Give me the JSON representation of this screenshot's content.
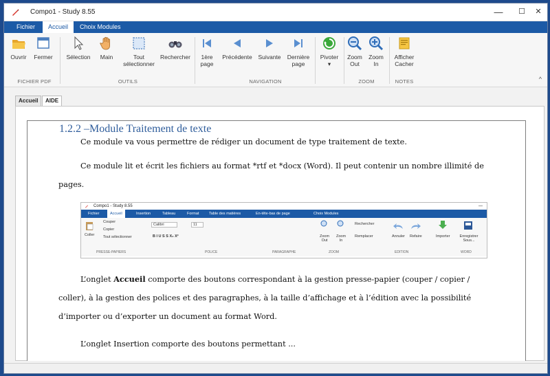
{
  "window": {
    "title": "Compo1 - Study 8.55",
    "controls": {
      "minimize": "—",
      "maximize": "☐",
      "close": "✕"
    }
  },
  "menubar": {
    "tabs": [
      {
        "label": "Fichier"
      },
      {
        "label": "Accueil"
      },
      {
        "label": "Choix Modules"
      }
    ]
  },
  "ribbon": {
    "buttons": {
      "ouvrir": "Ouvrir",
      "fermer": "Fermer",
      "selection": "Sélection",
      "main": "Main",
      "tout_sel_1": "Tout",
      "tout_sel_2": "sélectionner",
      "rechercher": "Rechercher",
      "premiere_1": "1ère",
      "premiere_2": "page",
      "precedente": "Précédente",
      "suivante": "Suivante",
      "derniere_1": "Dernière",
      "derniere_2": "page",
      "pivoter": "Pivoter",
      "pivoter_arrow": "▾",
      "zoomout_1": "Zoom",
      "zoomout_2": "Out",
      "zoomin_1": "Zoom",
      "zoomin_2": "In",
      "afficher_1": "Afficher",
      "afficher_2": "Cacher"
    },
    "groups": {
      "fichier_pdf": "FICHIER PDF",
      "outils": "OUTILS",
      "navigation": "NAVIGATION",
      "zoom": "ZOOM",
      "notes": "NOTES"
    },
    "collapse": "^"
  },
  "doc_tabs": [
    {
      "label": "Accueil"
    },
    {
      "label": "AIDE"
    }
  ],
  "document": {
    "heading": "1.2.2 –Module Traitement de texte",
    "p1": "Ce module va vous permettre de rédiger un document de type traitement de texte.",
    "p2": "Ce module lit et écrit les fichiers au format *rtf et *docx (Word). Il peut contenir un nombre illimité de pages.",
    "p3_before": "L’onglet ",
    "p3_bold": "Accueil",
    "p3_after": " comporte des boutons correspondant à la gestion presse-papier (couper / copier / coller), à la gestion des polices et des paragraphes, à la taille d’affichage et à l’édition avec la possibilité d’importer ou d’exporter un document au format Word.",
    "p4_partial": "L’onglet Insertion comporte des boutons permettant ..."
  },
  "embedded_screenshot": {
    "title": "Compo1 - Study 8.55",
    "close": "—",
    "tabs": [
      "Fichier",
      "Accueil",
      "Insertion",
      "Tableau",
      "Format",
      "Table des matières",
      "En-tête-bas de page",
      "Choix Modules"
    ],
    "coller": "Coller",
    "couper": "Couper",
    "copier": "Copier",
    "tout_sel": "Tout sélectionner",
    "font": "Calibri",
    "size": "11",
    "fmt_row": "B  I  U  S  S  X₂  X²",
    "rechercher": "Rechercher",
    "remplacer": "Remplacer",
    "annuler": "Annuler",
    "refaire": "Refaire",
    "zoomout": "Zoom Out",
    "zoomin": "Zoom In",
    "importer": "Importer",
    "enregistrer": "Enregistrer Sous...",
    "groups": [
      "PRESSE-PAPIERS",
      "POLICE",
      "PARAGRAPHE",
      "ZOOM",
      "EDITION",
      "WORD"
    ]
  }
}
